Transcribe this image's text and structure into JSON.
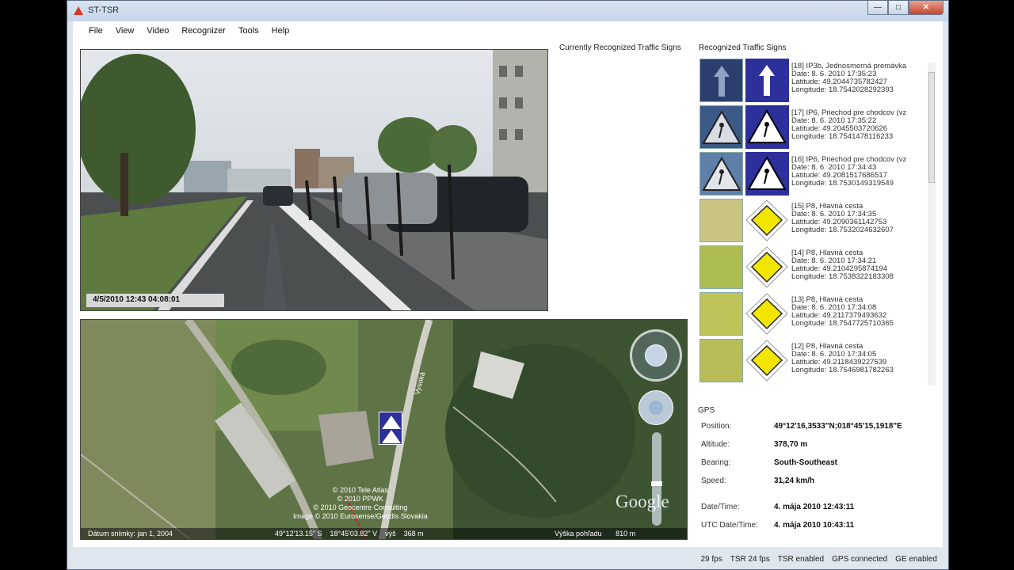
{
  "window": {
    "title": "ST-TSR"
  },
  "menu": [
    "File",
    "View",
    "Video",
    "Recognizer",
    "Tools",
    "Help"
  ],
  "labels": {
    "current_signs": "Currently Recognized Traffic Signs",
    "recognized_signs": "Recognized Traffic Signs",
    "gps": "GPS"
  },
  "video": {
    "timestamp": "4/5/2010 12:43 04:08:01"
  },
  "signs": [
    {
      "name": "[18] IP3b, Jednosmerná premávka",
      "date": "Date: 8. 6. 2010 17:35:23",
      "lat": "Latitude: 49.2044735782427",
      "lon": "Longitude: 18.7542028292393",
      "type": "arrow"
    },
    {
      "name": "[17] IP6, Priechod pre chodcov (vz",
      "date": "Date: 8. 6. 2010 17:35:22",
      "lat": "Latitude: 49.2045503720626",
      "lon": "Longitude: 18.7541478116233",
      "type": "crosswalk"
    },
    {
      "name": "[16] IP6, Priechod pre chodcov (vz",
      "date": "Date: 8. 6. 2010 17:34:43",
      "lat": "Latitude: 49.2081517686517",
      "lon": "Longitude: 18.7530149319549",
      "type": "crosswalk"
    },
    {
      "name": "[15] P8, Hlavná cesta",
      "date": "Date: 8. 6. 2010 17:34:35",
      "lat": "Latitude: 49.2090361142753",
      "lon": "Longitude: 18.7532024632607",
      "type": "priority"
    },
    {
      "name": "[14] P8, Hlavná cesta",
      "date": "Date: 8. 6. 2010 17:34:21",
      "lat": "Latitude: 49.2104295874194",
      "lon": "Longitude: 18.7538322183308",
      "type": "priority"
    },
    {
      "name": "[13] P8, Hlavná cesta",
      "date": "Date: 8. 6. 2010 17:34:08",
      "lat": "Latitude: 49.2117379493632",
      "lon": "Longitude: 18.7547725710365",
      "type": "priority"
    },
    {
      "name": "[12] P8, Hlavná cesta",
      "date": "Date: 8. 6. 2010 17:34:05",
      "lat": "Latitude: 49.2118439227539",
      "lon": "Longitude: 18.7546981782263",
      "type": "priority"
    }
  ],
  "gps": [
    {
      "label": "Position:",
      "value": "49°12'16,3533\"N;018°45'15,1918\"E"
    },
    {
      "label": "Altitude:",
      "value": "378,70 m"
    },
    {
      "label": "Bearing:",
      "value": "South-Southeast"
    },
    {
      "label": "Speed:",
      "value": "31,24 km/h"
    },
    {
      "label": "Date/Time:",
      "value": "4. mája 2010 12:43:11"
    },
    {
      "label": "UTC Date/Time:",
      "value": "4. mája 2010 10:43:11"
    }
  ],
  "map": {
    "date": "Dátum snímky: jan 1, 2004",
    "coords": "49°12'13.15\" S    18°45'03.82\" V    výš    368 m",
    "eye": "Výška pohľadu       810 m",
    "copyright_lines": [
      "© 2010 Tele Atlas",
      "© 2010 PPWK",
      "© 2010 Geocentre Consulting",
      "Image © 2010 Eurosense/Geodis Slovakia"
    ],
    "google": "Google",
    "road_label": "Vysoká"
  },
  "status": [
    "29 fps",
    "TSR 24 fps",
    "TSR enabled",
    "GPS connected",
    "GE enabled"
  ]
}
